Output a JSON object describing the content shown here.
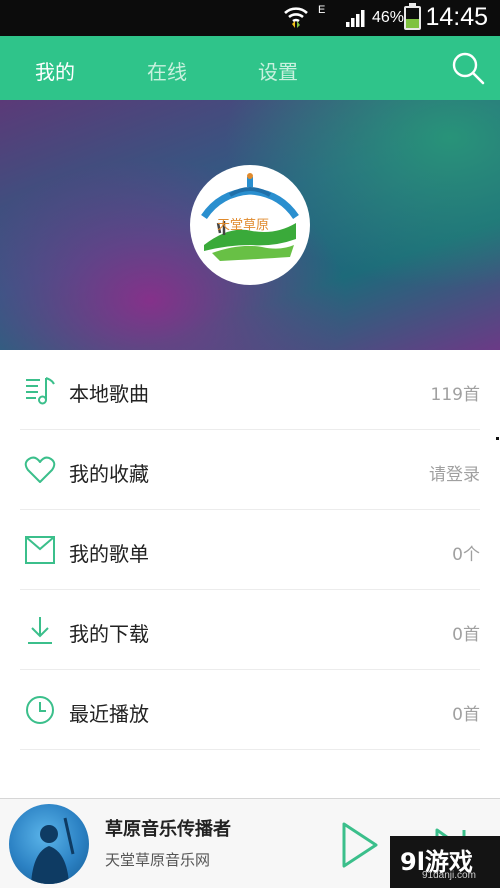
{
  "status_bar": {
    "network_type": "E",
    "battery_percent": "46%",
    "battery_level": 0.46,
    "time": "14:45"
  },
  "nav": {
    "tabs": [
      {
        "label": "我的",
        "active": true
      },
      {
        "label": "在线",
        "active": false
      },
      {
        "label": "设置",
        "active": false
      }
    ],
    "search_icon": "search-icon"
  },
  "banner": {
    "logo_text": "天堂草原"
  },
  "menu": {
    "items": [
      {
        "label": "本地歌曲",
        "value": "119首",
        "icon": "music-list-icon"
      },
      {
        "label": "我的收藏",
        "value": "请登录",
        "icon": "heart-icon"
      },
      {
        "label": "我的歌单",
        "value": "0个",
        "icon": "playlist-box-icon"
      },
      {
        "label": "我的下载",
        "value": "0首",
        "icon": "download-icon"
      },
      {
        "label": "最近播放",
        "value": "0首",
        "icon": "clock-icon"
      }
    ]
  },
  "player": {
    "title": "草原音乐传播者",
    "subtitle": "天堂草原音乐网"
  },
  "watermark": {
    "brand": "9l游戏",
    "url": "91danji.com"
  },
  "colors": {
    "accent": "#2fc48a",
    "icon_green": "#3bbf8b",
    "value_gray": "#a0a0a0"
  }
}
